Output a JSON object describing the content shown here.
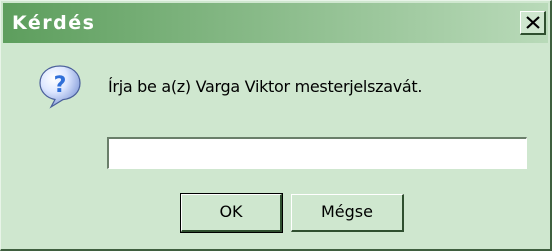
{
  "dialog": {
    "title": "Kérdés",
    "close_label": "close",
    "icon": "question-icon",
    "prompt": "Írja be a(z) Varga Viktor mesterjelszavát.",
    "input": {
      "value": "",
      "placeholder": ""
    },
    "ok_label": "OK",
    "cancel_label": "Mégse"
  },
  "colors": {
    "window_bg": "#cfe7cf",
    "title_gradient_start": "#5d9e5d",
    "title_gradient_end": "#b9dab9",
    "icon_blue": "#3a7bd5"
  }
}
